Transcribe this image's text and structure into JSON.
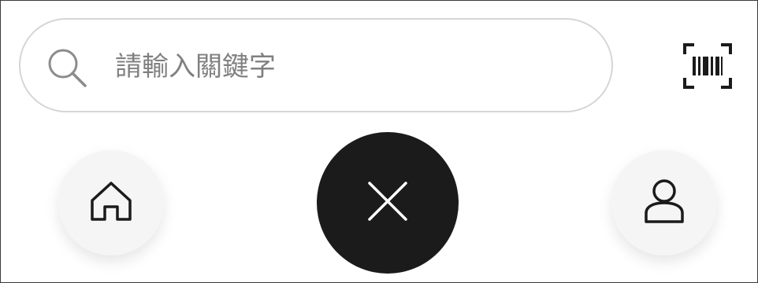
{
  "search": {
    "placeholder": "請輸入關鍵字",
    "value": "",
    "icon": "search-icon"
  },
  "toolbar": {
    "barcode_icon": "barcode-scan-icon"
  },
  "nav": {
    "home_icon": "home-icon",
    "close_icon": "close-icon",
    "user_icon": "user-icon"
  },
  "colors": {
    "border": "#d6d6d6",
    "icon_gray": "#8c8c8c",
    "icon_dark": "#1b1b1b",
    "button_light": "#f5f5f5",
    "button_dark": "#1b1b1b",
    "close_icon": "#ffffff"
  }
}
